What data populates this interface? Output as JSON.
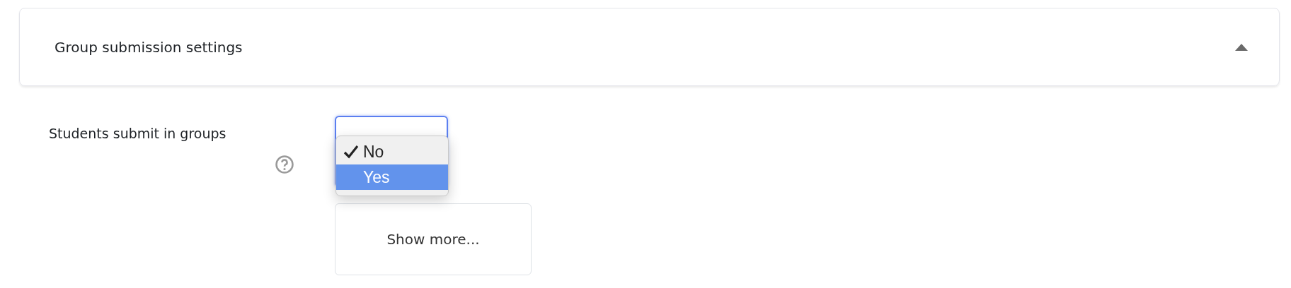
{
  "section": {
    "title": "Group submission settings",
    "expanded": true
  },
  "field": {
    "label": "Students submit in groups",
    "options": [
      {
        "label": "No",
        "checked": true,
        "highlighted": false
      },
      {
        "label": "Yes",
        "checked": false,
        "highlighted": true
      }
    ]
  },
  "show_more": {
    "label": "Show more..."
  }
}
